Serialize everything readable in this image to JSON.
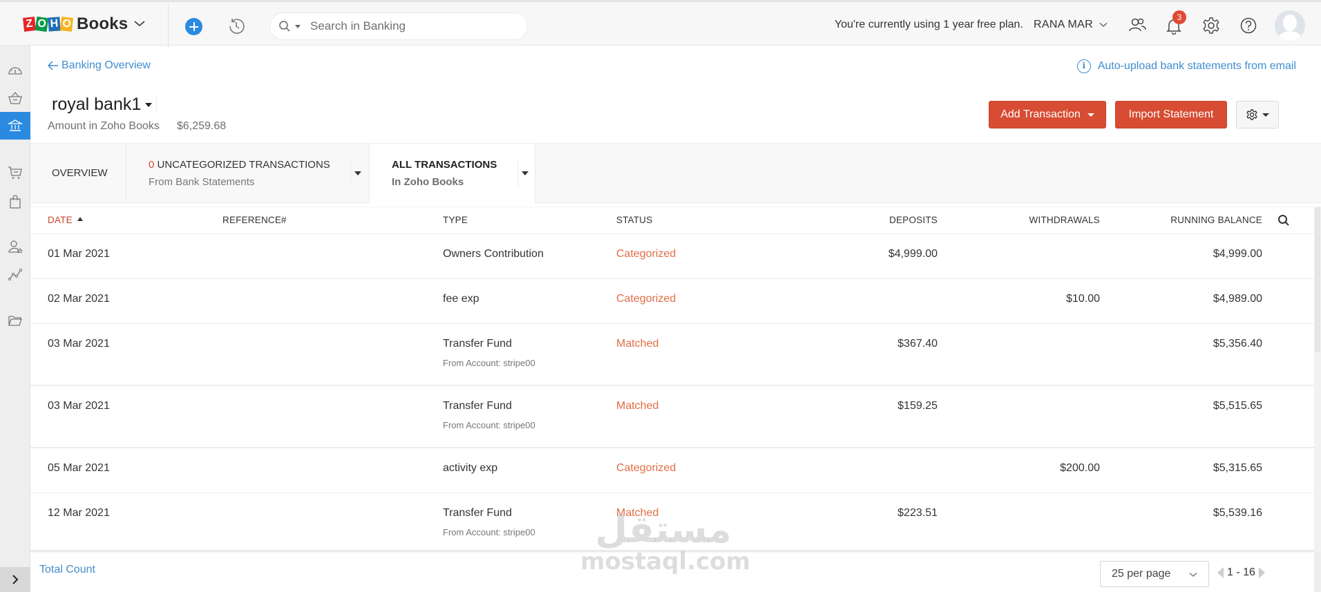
{
  "topbar": {
    "logo_letters": [
      {
        "char": "Z",
        "color": "#e42527"
      },
      {
        "char": "O",
        "color": "#089949"
      },
      {
        "char": "H",
        "color": "#226db4"
      },
      {
        "char": "O",
        "color": "#f9b21d"
      }
    ],
    "app_name": "Books",
    "search_placeholder": "Search in Banking",
    "plan_text": "You're currently using 1 year free plan.",
    "user_name": "RANA MAR",
    "notification_count": "3",
    "icons": [
      "plus-icon",
      "history-icon",
      "search-icon",
      "users-icon",
      "bell-icon",
      "gear-icon",
      "help-icon",
      "avatar"
    ]
  },
  "sidebar": {
    "items": [
      {
        "name": "dashboard",
        "icon": "dashboard-icon",
        "active": false
      },
      {
        "name": "items",
        "icon": "basket-icon",
        "active": false
      },
      {
        "name": "banking",
        "icon": "bank-icon",
        "active": true
      },
      {
        "name": "sales",
        "icon": "cart-icon",
        "active": false
      },
      {
        "name": "purchases",
        "icon": "bag-icon",
        "active": false
      },
      {
        "name": "accountant",
        "icon": "user-star-icon",
        "active": false
      },
      {
        "name": "reports",
        "icon": "chart-icon",
        "active": false
      },
      {
        "name": "documents",
        "icon": "folder-icon",
        "active": false
      }
    ],
    "expand_icon": "chevron-right-icon"
  },
  "page": {
    "back_link": "Banking Overview",
    "auto_upload_link": "Auto-upload bank statements from email",
    "account_name": "royal bank1",
    "amount_label": "Amount in Zoho Books",
    "amount_value": "$6,259.68",
    "add_transaction_label": "Add Transaction",
    "import_statement_label": "Import Statement"
  },
  "tabs": {
    "overview": "OVERVIEW",
    "uncategorized_count": "0",
    "uncategorized_title": " UNCATEGORIZED TRANSACTIONS",
    "uncategorized_sub": "From Bank Statements",
    "all_title": "ALL TRANSACTIONS",
    "all_sub": "In Zoho Books"
  },
  "table": {
    "headers": {
      "date": "DATE",
      "reference": "REFERENCE#",
      "type": "TYPE",
      "status": "STATUS",
      "deposits": "DEPOSITS",
      "withdrawals": "WITHDRAWALS",
      "running_balance": "RUNNING BALANCE"
    },
    "sort": {
      "column": "date",
      "direction": "ascending"
    },
    "rows": [
      {
        "date": "01 Mar 2021",
        "reference": "",
        "type": "Owners Contribution",
        "type_sub": "",
        "status": "Categorized",
        "deposits": "$4,999.00",
        "withdrawals": "",
        "balance": "$4,999.00"
      },
      {
        "date": "02 Mar 2021",
        "reference": "",
        "type": "fee exp",
        "type_sub": "",
        "status": "Categorized",
        "deposits": "",
        "withdrawals": "$10.00",
        "balance": "$4,989.00"
      },
      {
        "date": "03 Mar 2021",
        "reference": "",
        "type": "Transfer Fund",
        "type_sub": "From Account: stripe00",
        "status": "Matched",
        "deposits": "$367.40",
        "withdrawals": "",
        "balance": "$5,356.40"
      },
      {
        "date": "03 Mar 2021",
        "reference": "",
        "type": "Transfer Fund",
        "type_sub": "From Account: stripe00",
        "status": "Matched",
        "deposits": "$159.25",
        "withdrawals": "",
        "balance": "$5,515.65"
      },
      {
        "date": "05 Mar 2021",
        "reference": "",
        "type": "activity exp",
        "type_sub": "",
        "status": "Categorized",
        "deposits": "",
        "withdrawals": "$200.00",
        "balance": "$5,315.65"
      },
      {
        "date": "12 Mar 2021",
        "reference": "",
        "type": "Transfer Fund",
        "type_sub": "From Account: stripe00",
        "status": "Matched",
        "deposits": "$223.51",
        "withdrawals": "",
        "balance": "$5,539.16"
      }
    ]
  },
  "footer": {
    "total_count_label": "Total Count",
    "per_page": "25 per page",
    "range": "1 - 16"
  },
  "watermark": {
    "arabic": "مستقل",
    "latin": "mostaql.com"
  },
  "colors": {
    "accent_blue": "#2a8ae0",
    "link_blue": "#408dcf",
    "primary_red": "#d74c32",
    "status_orange": "#e16d45"
  }
}
